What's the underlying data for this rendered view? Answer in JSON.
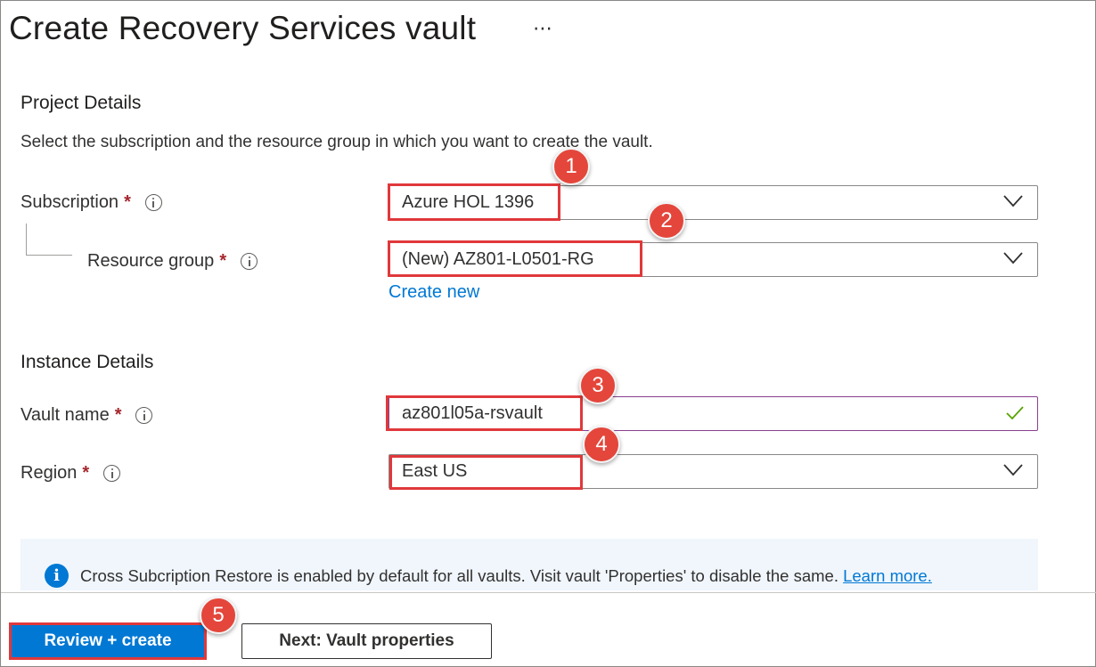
{
  "page": {
    "title": "Create Recovery Services vault",
    "more_actions": "⋯"
  },
  "project_details": {
    "heading": "Project Details",
    "description": "Select the subscription and the resource group in which you want to create the vault.",
    "subscription": {
      "label": "Subscription",
      "required_mark": "*",
      "value": "Azure HOL 1396"
    },
    "resource_group": {
      "label": "Resource group",
      "required_mark": "*",
      "value": "(New) AZ801-L0501-RG",
      "create_new": "Create new"
    }
  },
  "instance_details": {
    "heading": "Instance Details",
    "vault_name": {
      "label": "Vault name",
      "required_mark": "*",
      "value": "az801l05a-rsvault",
      "valid": true
    },
    "region": {
      "label": "Region",
      "required_mark": "*",
      "value": "East US"
    }
  },
  "info_bar": {
    "icon": "info-icon",
    "text": "Cross Subcription Restore is enabled by default for all vaults. Visit vault 'Properties' to disable the same.",
    "link": "Learn more."
  },
  "footer": {
    "primary_button": "Review + create",
    "secondary_button": "Next: Vault properties"
  },
  "annotations": {
    "badges": [
      "1",
      "2",
      "3",
      "4",
      "5"
    ],
    "highlight_color": "#e0383b",
    "badge_color": "#e4463b"
  },
  "colors": {
    "accent": "#0078d4",
    "required": "#a4262c",
    "valid_check": "#57a300"
  }
}
